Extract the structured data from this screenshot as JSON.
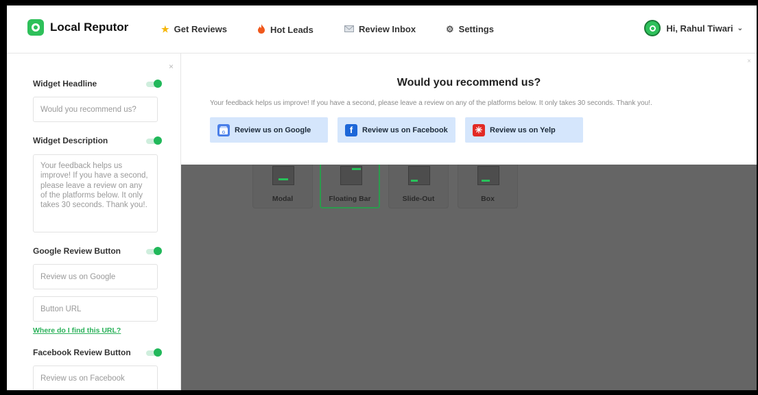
{
  "app": {
    "name": "Local Reputor"
  },
  "nav": {
    "items": [
      {
        "label": "Get Reviews",
        "icon": "star-icon"
      },
      {
        "label": "Hot Leads",
        "icon": "fire-icon"
      },
      {
        "label": "Review Inbox",
        "icon": "mail-icon"
      },
      {
        "label": "Settings",
        "icon": "gear-icon"
      }
    ],
    "user_greeting": "Hi, Rahul Tiwari"
  },
  "panel": {
    "close": "×",
    "headline": {
      "label": "Widget Headline",
      "enabled": true,
      "placeholder": "Would you recommend us?"
    },
    "description": {
      "label": "Widget Description",
      "enabled": true,
      "text": "Your feedback helps us improve! If you have a second, please leave a review on any of the platforms below. It only takes 30 seconds. Thank you!."
    },
    "google": {
      "label": "Google Review Button",
      "enabled": true,
      "text_placeholder": "Review us on Google",
      "url_placeholder": "Button URL",
      "help_link": "Where do I find this URL?"
    },
    "facebook": {
      "label": "Facebook Review Button",
      "enabled": true,
      "text_placeholder": "Review us on Facebook"
    }
  },
  "widget_types": [
    {
      "label": "Modal",
      "active": false
    },
    {
      "label": "Floating Bar",
      "active": true
    },
    {
      "label": "Slide-Out",
      "active": false
    },
    {
      "label": "Box",
      "active": false
    }
  ],
  "preview": {
    "close": "×",
    "title": "Would you recommend us?",
    "description": "Your feedback helps us improve! If you have a second, please leave a review on any of the platforms below. It only takes 30 seconds. Thank you!.",
    "buttons": [
      {
        "label": "Review us on Google",
        "icon": "google-business-icon",
        "color": "#4a7fe8"
      },
      {
        "label": "Review us on Facebook",
        "icon": "facebook-icon",
        "color": "#1d67d8"
      },
      {
        "label": "Review us on Yelp",
        "icon": "yelp-icon",
        "color": "#e22a24"
      }
    ]
  },
  "colors": {
    "accent": "#2ec05a",
    "overlay": "#656565",
    "button_bg": "#d5e6fc"
  }
}
